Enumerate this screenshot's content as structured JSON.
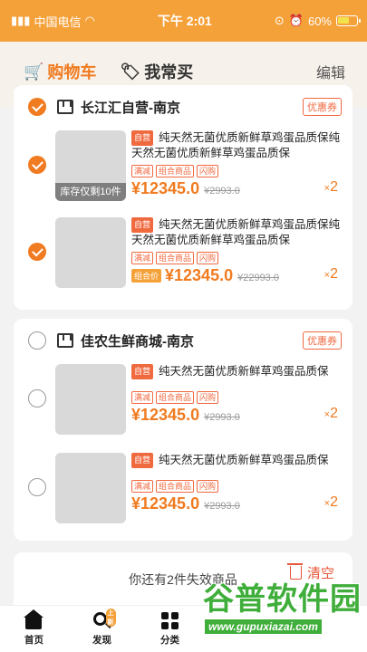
{
  "status": {
    "carrier": "中国电信",
    "time": "下午 2:01",
    "battery": "60%"
  },
  "header": {
    "tab_cart": "购物车",
    "tab_bought": "我常买",
    "edit": "编辑"
  },
  "stores": [
    {
      "name": "长江汇自营-南京",
      "coupon": "优惠券",
      "items": [
        {
          "self_tag": "自营",
          "title": "纯天然无菌优质新鲜草鸡蛋品质保纯天然无菌优质新鲜草鸡蛋品质保",
          "promos": [
            "满减",
            "组合商品",
            "闪购"
          ],
          "price": "¥12345.0",
          "old_price": "¥2993.0",
          "qty": "2",
          "qty_prefix": "×",
          "stock": "库存仅剩10件",
          "combo": ""
        },
        {
          "self_tag": "自营",
          "title": "纯天然无菌优质新鲜草鸡蛋品质保纯天然无菌优质新鲜草鸡蛋品质保",
          "promos": [
            "满减",
            "组合商品",
            "闪购"
          ],
          "price": "¥12345.0",
          "old_price": "¥22993.0",
          "qty": "2",
          "qty_prefix": "×",
          "stock": "",
          "combo": "组合价"
        }
      ]
    },
    {
      "name": "佳农生鲜商城-南京",
      "coupon": "优惠券",
      "items": [
        {
          "self_tag": "自营",
          "title": "纯天然无菌优质新鲜草鸡蛋品质保",
          "promos": [
            "满减",
            "组合商品",
            "闪购"
          ],
          "price": "¥12345.0",
          "old_price": "¥2993.0",
          "qty": "2",
          "qty_prefix": "×",
          "stock": "",
          "combo": ""
        },
        {
          "self_tag": "自营",
          "title": "纯天然无菌优质新鲜草鸡蛋品质保",
          "promos": [
            "满减",
            "组合商品",
            "闪购"
          ],
          "price": "¥12345.0",
          "old_price": "¥2993.0",
          "qty": "2",
          "qty_prefix": "×",
          "stock": "",
          "combo": ""
        }
      ]
    }
  ],
  "invalid": {
    "text": "你还有2件失效商品",
    "clear": "清空"
  },
  "nav": {
    "home": "首页",
    "discover": "发现",
    "discover_badge": "上新",
    "category": "分类"
  },
  "watermark": {
    "title": "谷普软件园",
    "url": "www.gupuxiazai.com"
  },
  "colors": {
    "accent": "#f07b20",
    "status_bar": "#f5a13a",
    "promo": "#f06a40"
  }
}
